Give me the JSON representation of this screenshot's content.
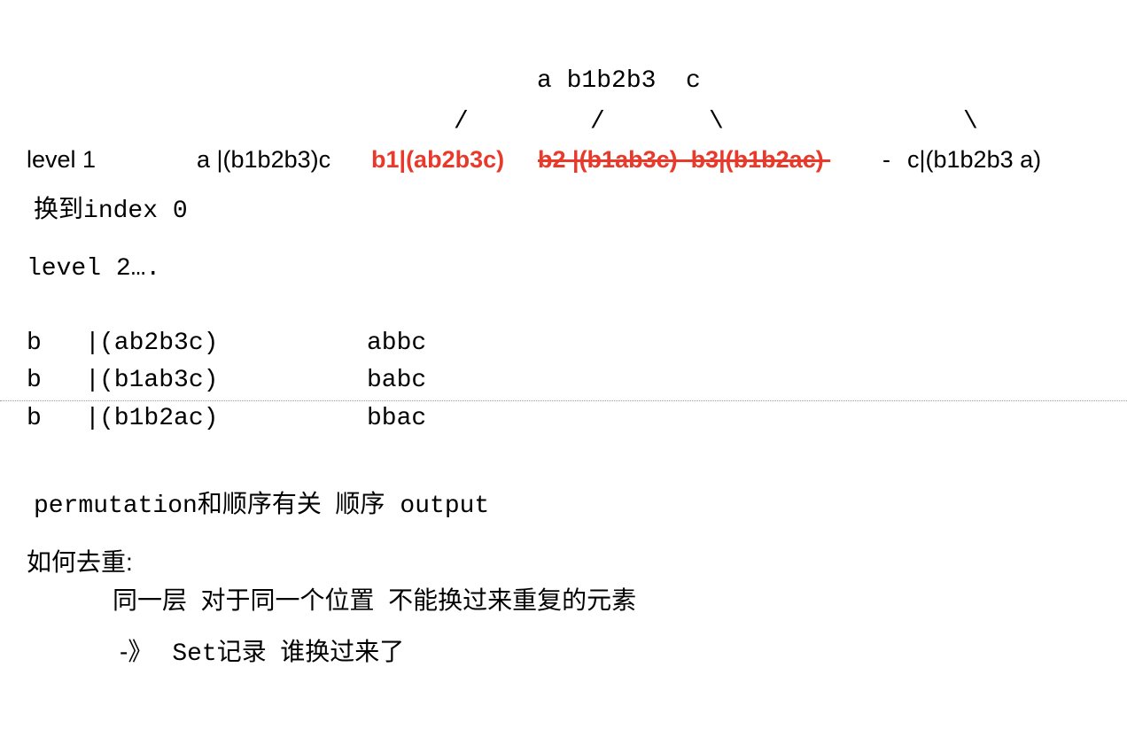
{
  "colors": {
    "text": "#000000",
    "highlight_red": "#e8392b",
    "divider": "#9a9a9a"
  },
  "tree": {
    "top_label": "a b1b2b3  c",
    "slash_1": "/",
    "slash_2": "/",
    "backslash_1": "\\",
    "backslash_2": "\\"
  },
  "level1": {
    "label": "level 1",
    "node_a": "a |(b1b2b3)c",
    "node_b1": "b1|(ab2b3c)",
    "node_b2_b3_struck": "b2 |(b1ab3c)  b3|(b1b2ac) ",
    "dash": "-",
    "node_c": "c|(b1b2b3 a)"
  },
  "swap_line": {
    "cjk": "换到",
    "rest": "index 0"
  },
  "level2": {
    "label": "level 2…."
  },
  "rows": [
    {
      "prefix": "b  ",
      "bar": "|",
      "paren": "(ab2b3c)",
      "result": "abbc"
    },
    {
      "prefix": "b  ",
      "bar": "|",
      "paren": "(b1ab3c)",
      "result": "babc"
    },
    {
      "prefix": "b  ",
      "bar": "|",
      "paren": "(b1b2ac)",
      "result": "bbac"
    }
  ],
  "permutation": {
    "word": "permutation",
    "cjk": "和顺序有关  顺序",
    "output": "output"
  },
  "dedup": {
    "title": "如何去重:",
    "line1": "同一层  对于同一个位置  不能换过来重复的元素",
    "arrow": "-》",
    "set_word": "Set",
    "line2_cjk": "记录  谁换过来了"
  }
}
